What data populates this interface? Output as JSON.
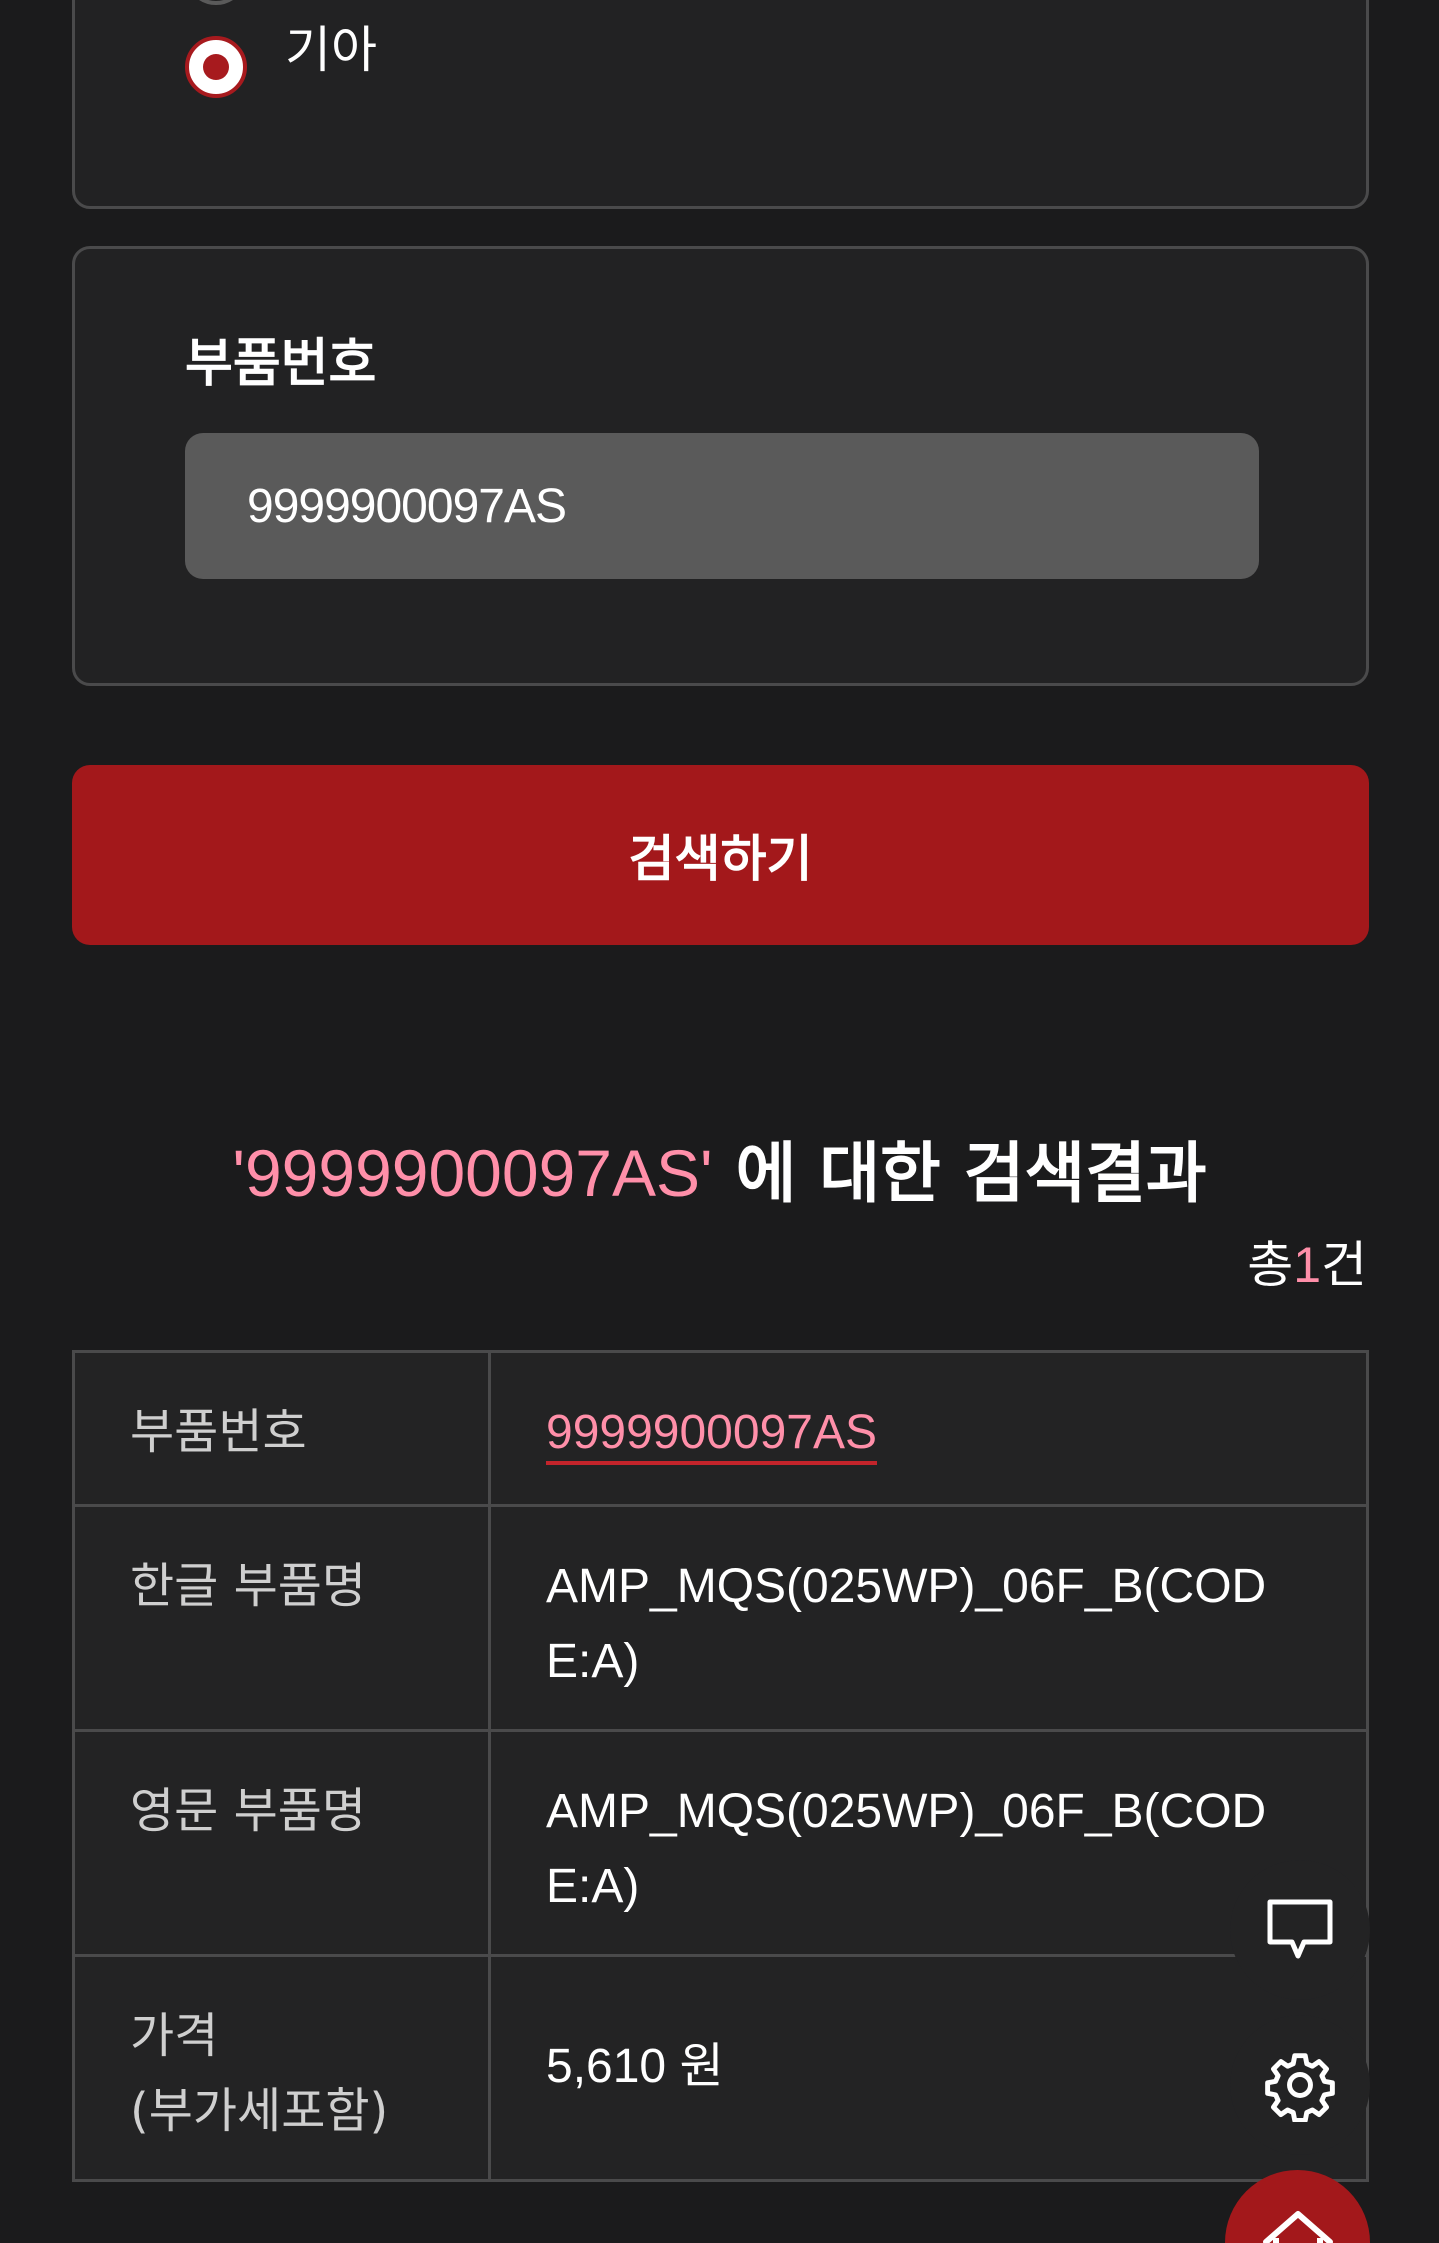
{
  "brand_selector": {
    "selected_option": "기아"
  },
  "part_search": {
    "label": "부품번호",
    "input_value": "9999900097AS",
    "submit_label": "검색하기"
  },
  "results": {
    "query_display": "'9999900097AS'",
    "heading_suffix": " 에 대한 검색결과",
    "total_prefix": "총",
    "total_count": "1",
    "total_suffix": "건",
    "table": {
      "part_number_label": "부품번호",
      "part_number_value": "9999900097AS",
      "korean_name_label": "한글 부품명",
      "korean_name_value": "AMP_MQS(025WP)_06F_B(CODE:A)",
      "english_name_label": "영문 부품명",
      "english_name_value": "AMP_MQS(025WP)_06F_B(CODE:A)",
      "price_label_line1": "가격",
      "price_label_line2": "(부가세포함)",
      "price_value": "5,610 원"
    }
  },
  "floating_buttons": {
    "chat_icon": "chat-bubble-icon",
    "settings_icon": "gear-icon",
    "home_icon": "home-icon"
  },
  "colors": {
    "accent_red": "#a3181b",
    "highlight_pink": "#ff8fa9",
    "background": "#1b1b1c",
    "input_bg": "#5a5a5a"
  }
}
